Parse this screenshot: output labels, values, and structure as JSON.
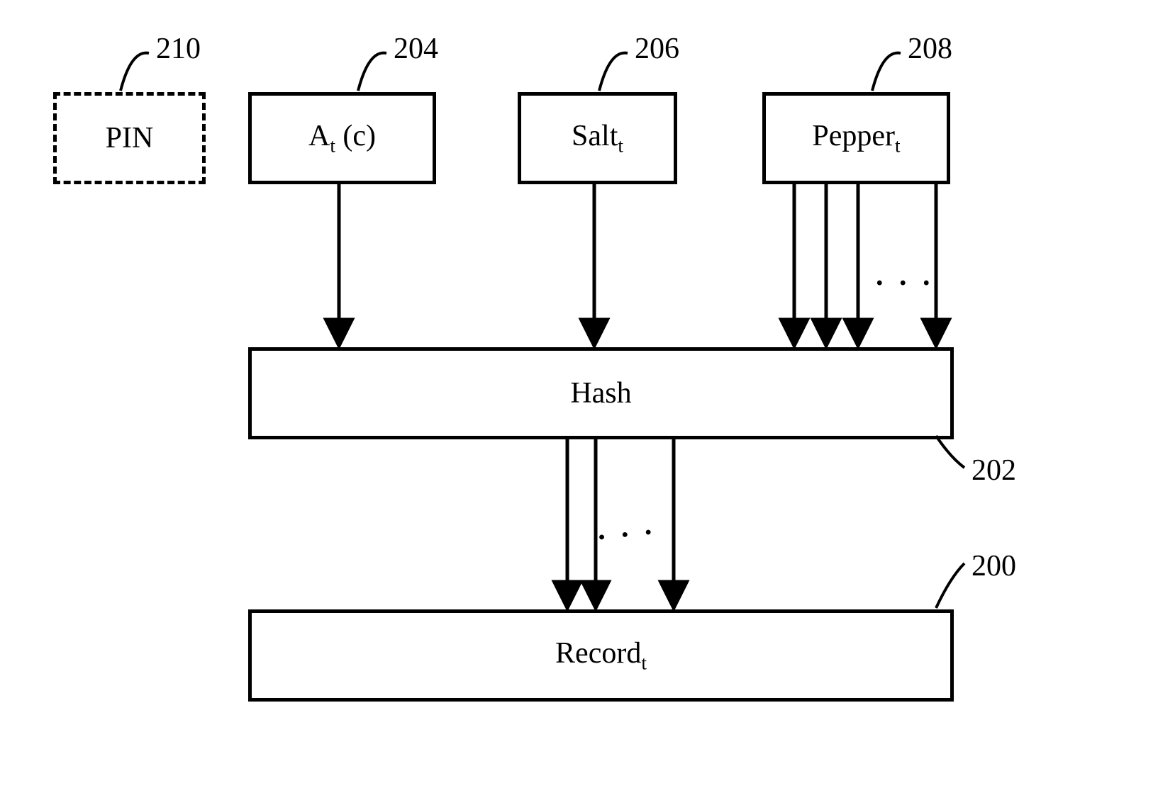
{
  "nodes": {
    "pin": {
      "ref": "210",
      "text": "PIN"
    },
    "atc": {
      "ref": "204",
      "text_html": "A<span class=\"sub\">t</span> (c)"
    },
    "salt": {
      "ref": "206",
      "text_html": "Salt<span class=\"sub\">t</span>"
    },
    "pepper": {
      "ref": "208",
      "text_html": "Pepper<span class=\"sub\">t</span>"
    },
    "hash": {
      "ref": "202",
      "text": "Hash"
    },
    "record": {
      "ref": "200",
      "text_html": "Record<span class=\"sub\">t</span>"
    }
  },
  "ellipsis": ". . ."
}
